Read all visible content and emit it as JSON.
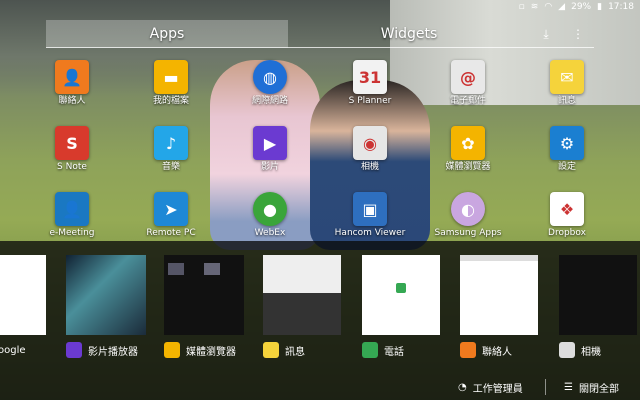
{
  "status_bar": {
    "battery": "29%",
    "time": "17:18"
  },
  "tabs": {
    "apps": "Apps",
    "widgets": "Widgets"
  },
  "apps": [
    {
      "label": "聯絡人",
      "icon": "person-icon",
      "color": "#f07a1e",
      "glyph": "👤"
    },
    {
      "label": "我的檔案",
      "icon": "folder-icon",
      "color": "#f4b400",
      "glyph": "▬"
    },
    {
      "label": "網際網路",
      "icon": "globe-icon",
      "color": "#1f6fd6",
      "glyph": "◍"
    },
    {
      "label": "S Planner",
      "icon": "calendar-icon",
      "color": "#f2f2f2",
      "glyph": "31"
    },
    {
      "label": "電子郵件",
      "icon": "email-icon",
      "color": "#e8e8e8",
      "glyph": "@"
    },
    {
      "label": "訊息",
      "icon": "message-icon",
      "color": "#f5d33b",
      "glyph": "✉"
    },
    {
      "label": "S Note",
      "icon": "snote-icon",
      "color": "#d83a2c",
      "glyph": "S"
    },
    {
      "label": "音樂",
      "icon": "music-icon",
      "color": "#23a6e8",
      "glyph": "♪"
    },
    {
      "label": "影片",
      "icon": "video-icon",
      "color": "#6b3ad1",
      "glyph": "▶"
    },
    {
      "label": "相機",
      "icon": "camera-icon",
      "color": "#e6e6e6",
      "glyph": "◉"
    },
    {
      "label": "媒體瀏覽器",
      "icon": "gallery-icon",
      "color": "#f4b400",
      "glyph": "✿"
    },
    {
      "label": "設定",
      "icon": "settings-gear-icon",
      "color": "#1b7fd1",
      "glyph": "⚙"
    },
    {
      "label": "e-Meeting",
      "icon": "emeeting-icon",
      "color": "#1a78c2",
      "glyph": "👤"
    },
    {
      "label": "Remote PC",
      "icon": "remote-pc-icon",
      "color": "#1e88d6",
      "glyph": "➤"
    },
    {
      "label": "WebEx",
      "icon": "webex-icon",
      "color": "#3aa53a",
      "glyph": "●"
    },
    {
      "label": "Hancom Viewer",
      "icon": "hancom-icon",
      "color": "#2e6fbf",
      "glyph": "▣"
    },
    {
      "label": "Samsung Apps",
      "icon": "samsung-apps-icon",
      "color": "#c9a6e0",
      "glyph": "◐"
    },
    {
      "label": "Dropbox",
      "icon": "dropbox-icon",
      "color": "#ffffff",
      "glyph": "❖"
    }
  ],
  "recents": [
    {
      "label": "oogle",
      "icon": "google-icon",
      "color": "#ffffff"
    },
    {
      "label": "影片播放器",
      "icon": "video-player-icon",
      "color": "#6b3ad1"
    },
    {
      "label": "媒體瀏覽器",
      "icon": "gallery-icon",
      "color": "#f4b400"
    },
    {
      "label": "訊息",
      "icon": "message-icon",
      "color": "#f5d33b"
    },
    {
      "label": "電話",
      "icon": "phone-icon",
      "color": "#35a853"
    },
    {
      "label": "聯絡人",
      "icon": "contacts-icon",
      "color": "#f07a1e"
    },
    {
      "label": "相機",
      "icon": "camera-icon",
      "color": "#dddddd"
    }
  ],
  "actions": {
    "task_manager": "工作管理員",
    "close_all": "關閉全部"
  }
}
